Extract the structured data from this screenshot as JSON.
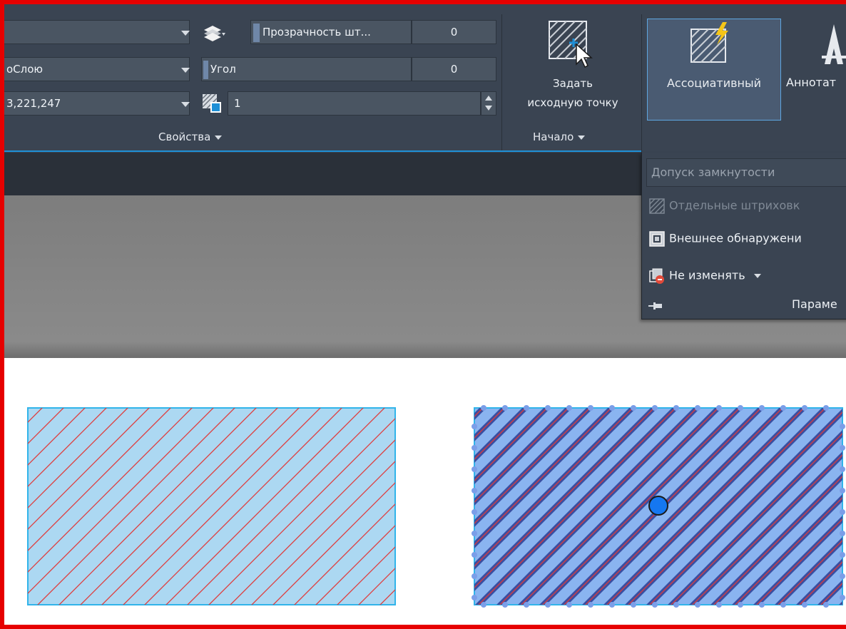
{
  "properties_panel": {
    "layer_value": "",
    "bylayer_value": "оСлою",
    "color_value": "3,221,247",
    "transparency_label": "Прозрачность шт...",
    "transparency_value": "0",
    "angle_label": "Угол",
    "angle_value": "0",
    "scale_value": "1",
    "title": "Свойства"
  },
  "origin_panel": {
    "button_label_line1": "Задать",
    "button_label_line2": "исходную точку",
    "title": "Начало"
  },
  "options_panel": {
    "associative_label": "Ассоциативный",
    "annotative_label": "Аннотат",
    "dropdown": {
      "gap_tolerance_placeholder": "Допуск замкнутости",
      "separate_hatches_label": "Отдельные штриховк",
      "outer_detection_label": "Внешнее обнаружени",
      "draw_order_label": "Не изменять",
      "title": "Параме"
    }
  },
  "icons": {
    "layer": "layers-icon",
    "hatch_scale": "hatch-scale-icon",
    "set_origin": "set-origin-icon",
    "associative": "associative-hatch-icon",
    "annotative": "annotative-icon",
    "separate_hatches": "separate-hatches-icon",
    "outer_detection": "outer-island-detection-icon",
    "draw_order": "draw-order-icon",
    "pin": "pin-icon"
  },
  "colors": {
    "ribbon_bg": "#3a4452",
    "accent_blue": "#1e8fd6",
    "hatch_fill_light": "#acd8f2",
    "hatch_fill_selected": "#8ab4f0",
    "hatch_line": "#e03a3a",
    "frame_border": "#e60000"
  }
}
